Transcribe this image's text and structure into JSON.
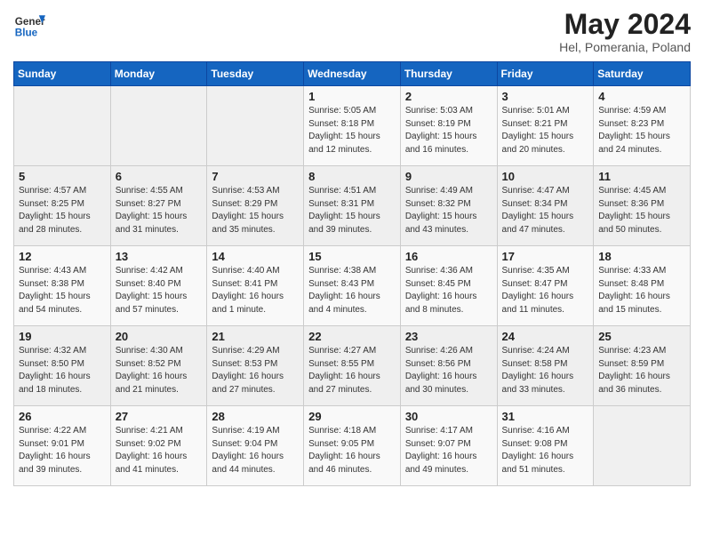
{
  "header": {
    "logo_general": "General",
    "logo_blue": "Blue",
    "month_title": "May 2024",
    "location": "Hel, Pomerania, Poland"
  },
  "weekdays": [
    "Sunday",
    "Monday",
    "Tuesday",
    "Wednesday",
    "Thursday",
    "Friday",
    "Saturday"
  ],
  "weeks": [
    [
      {
        "day": "",
        "sunrise": "",
        "sunset": "",
        "daylight": ""
      },
      {
        "day": "",
        "sunrise": "",
        "sunset": "",
        "daylight": ""
      },
      {
        "day": "",
        "sunrise": "",
        "sunset": "",
        "daylight": ""
      },
      {
        "day": "1",
        "sunrise": "Sunrise: 5:05 AM",
        "sunset": "Sunset: 8:18 PM",
        "daylight": "Daylight: 15 hours and 12 minutes."
      },
      {
        "day": "2",
        "sunrise": "Sunrise: 5:03 AM",
        "sunset": "Sunset: 8:19 PM",
        "daylight": "Daylight: 15 hours and 16 minutes."
      },
      {
        "day": "3",
        "sunrise": "Sunrise: 5:01 AM",
        "sunset": "Sunset: 8:21 PM",
        "daylight": "Daylight: 15 hours and 20 minutes."
      },
      {
        "day": "4",
        "sunrise": "Sunrise: 4:59 AM",
        "sunset": "Sunset: 8:23 PM",
        "daylight": "Daylight: 15 hours and 24 minutes."
      }
    ],
    [
      {
        "day": "5",
        "sunrise": "Sunrise: 4:57 AM",
        "sunset": "Sunset: 8:25 PM",
        "daylight": "Daylight: 15 hours and 28 minutes."
      },
      {
        "day": "6",
        "sunrise": "Sunrise: 4:55 AM",
        "sunset": "Sunset: 8:27 PM",
        "daylight": "Daylight: 15 hours and 31 minutes."
      },
      {
        "day": "7",
        "sunrise": "Sunrise: 4:53 AM",
        "sunset": "Sunset: 8:29 PM",
        "daylight": "Daylight: 15 hours and 35 minutes."
      },
      {
        "day": "8",
        "sunrise": "Sunrise: 4:51 AM",
        "sunset": "Sunset: 8:31 PM",
        "daylight": "Daylight: 15 hours and 39 minutes."
      },
      {
        "day": "9",
        "sunrise": "Sunrise: 4:49 AM",
        "sunset": "Sunset: 8:32 PM",
        "daylight": "Daylight: 15 hours and 43 minutes."
      },
      {
        "day": "10",
        "sunrise": "Sunrise: 4:47 AM",
        "sunset": "Sunset: 8:34 PM",
        "daylight": "Daylight: 15 hours and 47 minutes."
      },
      {
        "day": "11",
        "sunrise": "Sunrise: 4:45 AM",
        "sunset": "Sunset: 8:36 PM",
        "daylight": "Daylight: 15 hours and 50 minutes."
      }
    ],
    [
      {
        "day": "12",
        "sunrise": "Sunrise: 4:43 AM",
        "sunset": "Sunset: 8:38 PM",
        "daylight": "Daylight: 15 hours and 54 minutes."
      },
      {
        "day": "13",
        "sunrise": "Sunrise: 4:42 AM",
        "sunset": "Sunset: 8:40 PM",
        "daylight": "Daylight: 15 hours and 57 minutes."
      },
      {
        "day": "14",
        "sunrise": "Sunrise: 4:40 AM",
        "sunset": "Sunset: 8:41 PM",
        "daylight": "Daylight: 16 hours and 1 minute."
      },
      {
        "day": "15",
        "sunrise": "Sunrise: 4:38 AM",
        "sunset": "Sunset: 8:43 PM",
        "daylight": "Daylight: 16 hours and 4 minutes."
      },
      {
        "day": "16",
        "sunrise": "Sunrise: 4:36 AM",
        "sunset": "Sunset: 8:45 PM",
        "daylight": "Daylight: 16 hours and 8 minutes."
      },
      {
        "day": "17",
        "sunrise": "Sunrise: 4:35 AM",
        "sunset": "Sunset: 8:47 PM",
        "daylight": "Daylight: 16 hours and 11 minutes."
      },
      {
        "day": "18",
        "sunrise": "Sunrise: 4:33 AM",
        "sunset": "Sunset: 8:48 PM",
        "daylight": "Daylight: 16 hours and 15 minutes."
      }
    ],
    [
      {
        "day": "19",
        "sunrise": "Sunrise: 4:32 AM",
        "sunset": "Sunset: 8:50 PM",
        "daylight": "Daylight: 16 hours and 18 minutes."
      },
      {
        "day": "20",
        "sunrise": "Sunrise: 4:30 AM",
        "sunset": "Sunset: 8:52 PM",
        "daylight": "Daylight: 16 hours and 21 minutes."
      },
      {
        "day": "21",
        "sunrise": "Sunrise: 4:29 AM",
        "sunset": "Sunset: 8:53 PM",
        "daylight": "Daylight: 16 hours and 27 minutes."
      },
      {
        "day": "22",
        "sunrise": "Sunrise: 4:27 AM",
        "sunset": "Sunset: 8:55 PM",
        "daylight": "Daylight: 16 hours and 27 minutes."
      },
      {
        "day": "23",
        "sunrise": "Sunrise: 4:26 AM",
        "sunset": "Sunset: 8:56 PM",
        "daylight": "Daylight: 16 hours and 30 minutes."
      },
      {
        "day": "24",
        "sunrise": "Sunrise: 4:24 AM",
        "sunset": "Sunset: 8:58 PM",
        "daylight": "Daylight: 16 hours and 33 minutes."
      },
      {
        "day": "25",
        "sunrise": "Sunrise: 4:23 AM",
        "sunset": "Sunset: 8:59 PM",
        "daylight": "Daylight: 16 hours and 36 minutes."
      }
    ],
    [
      {
        "day": "26",
        "sunrise": "Sunrise: 4:22 AM",
        "sunset": "Sunset: 9:01 PM",
        "daylight": "Daylight: 16 hours and 39 minutes."
      },
      {
        "day": "27",
        "sunrise": "Sunrise: 4:21 AM",
        "sunset": "Sunset: 9:02 PM",
        "daylight": "Daylight: 16 hours and 41 minutes."
      },
      {
        "day": "28",
        "sunrise": "Sunrise: 4:19 AM",
        "sunset": "Sunset: 9:04 PM",
        "daylight": "Daylight: 16 hours and 44 minutes."
      },
      {
        "day": "29",
        "sunrise": "Sunrise: 4:18 AM",
        "sunset": "Sunset: 9:05 PM",
        "daylight": "Daylight: 16 hours and 46 minutes."
      },
      {
        "day": "30",
        "sunrise": "Sunrise: 4:17 AM",
        "sunset": "Sunset: 9:07 PM",
        "daylight": "Daylight: 16 hours and 49 minutes."
      },
      {
        "day": "31",
        "sunrise": "Sunrise: 4:16 AM",
        "sunset": "Sunset: 9:08 PM",
        "daylight": "Daylight: 16 hours and 51 minutes."
      },
      {
        "day": "",
        "sunrise": "",
        "sunset": "",
        "daylight": ""
      }
    ]
  ]
}
